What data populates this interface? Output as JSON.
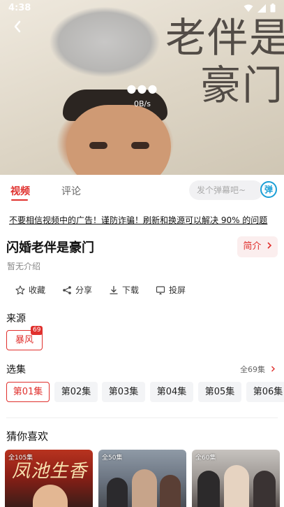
{
  "status_bar": {
    "time": "4:38"
  },
  "player": {
    "speed": "0B/s",
    "poster_text": "老伴是\n豪门"
  },
  "tabs": [
    {
      "label": "视频",
      "active": true
    },
    {
      "label": "评论",
      "active": false
    }
  ],
  "danmu": {
    "placeholder": "发个弹幕吧~",
    "button_label": "弹"
  },
  "notice": "不要相信视频中的广告！谨防诈骗！刷新和换源可以解决 90% 的问题",
  "show": {
    "title": "闪婚老伴是豪门",
    "intro_button": "简介",
    "description": "暂无介绍"
  },
  "actions": [
    {
      "label": "收藏",
      "icon": "star-icon"
    },
    {
      "label": "分享",
      "icon": "share-icon"
    },
    {
      "label": "下载",
      "icon": "download-icon"
    },
    {
      "label": "投屏",
      "icon": "cast-icon"
    }
  ],
  "source": {
    "heading": "来源",
    "name": "暴风",
    "badge": "69"
  },
  "episodes": {
    "heading": "选集",
    "total_label": "全69集",
    "items": [
      "第01集",
      "第02集",
      "第03集",
      "第04集",
      "第05集",
      "第06集"
    ],
    "selected_index": 0
  },
  "recommend": {
    "heading": "猜你喜欢",
    "items": [
      {
        "count": "全105集",
        "art_text": "凤池生香"
      },
      {
        "count": "全50集"
      },
      {
        "count": "全60集"
      }
    ]
  },
  "colors": {
    "accent": "#e0302d",
    "danmu": "#1b9fd6"
  }
}
